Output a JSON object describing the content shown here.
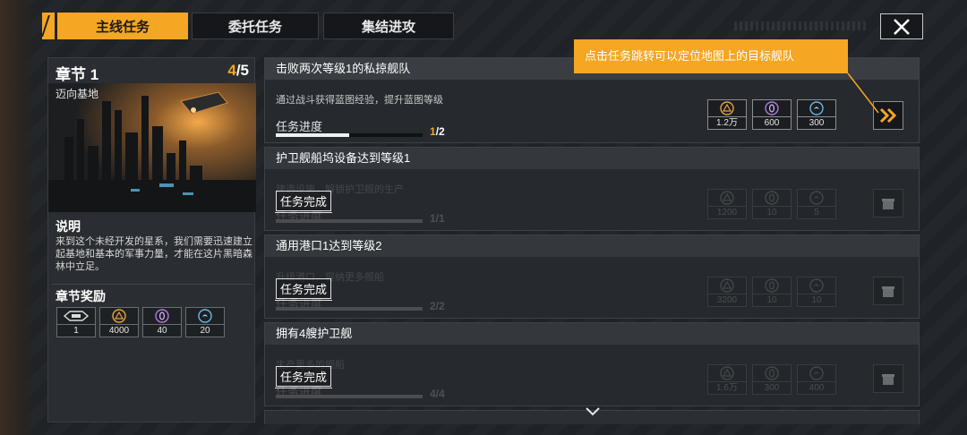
{
  "tabs": [
    {
      "label": "主线任务",
      "active": true
    },
    {
      "label": "委托任务",
      "active": false
    },
    {
      "label": "集结进攻",
      "active": false
    }
  ],
  "chapter": {
    "title": "章节 1",
    "progress_current": "4",
    "progress_total": "/5",
    "subtitle": "迈向基地",
    "desc_title": "说明",
    "desc_text": "来到这个未经开发的星系，我们需要迅速建立起基地和基本的军事力量，才能在这片黑暗森林中立足。",
    "reward_title": "章节奖励",
    "rewards": [
      {
        "icon": "ship-icon",
        "value": "1"
      },
      {
        "icon": "triangle-resource-icon",
        "value": "4000"
      },
      {
        "icon": "crystal-resource-icon",
        "value": "40"
      },
      {
        "icon": "gas-resource-icon",
        "value": "20"
      }
    ]
  },
  "tooltip": "点击任务跳转可以定位地图上的目标舰队",
  "quests": [
    {
      "title": "击败两次等级1的私掠舰队",
      "desc": "通过战斗获得蓝图经验，提升蓝图等级",
      "progress_label": "任务进度",
      "progress_current": "1",
      "progress_total": "/2",
      "progress_fraction": 0.5,
      "rewards": [
        "1.2万",
        "600",
        "300"
      ]
    },
    {
      "title": "护卫舰船坞设备达到等级1",
      "desc": "建造设施，解锁护卫舰的生产",
      "progress_label": "任务进度",
      "progress_value": "1/1",
      "status": "任务完成",
      "rewards": [
        "1200",
        "10",
        "5"
      ]
    },
    {
      "title": "通用港口1达到等级2",
      "desc": "升级港口，容纳更多舰船",
      "progress_label": "任务进度",
      "progress_value": "2/2",
      "status": "任务完成",
      "rewards": [
        "3200",
        "10",
        "10"
      ]
    },
    {
      "title": "拥有4艘护卫舰",
      "desc": "生产更多的舰船",
      "progress_label": "任务进度",
      "progress_value": "4/4",
      "status": "任务完成",
      "rewards": [
        "1.6万",
        "300",
        "400"
      ]
    }
  ],
  "colors": {
    "accent": "#f5a623",
    "panel": "#2a2d31",
    "background": "#1c1f23"
  }
}
